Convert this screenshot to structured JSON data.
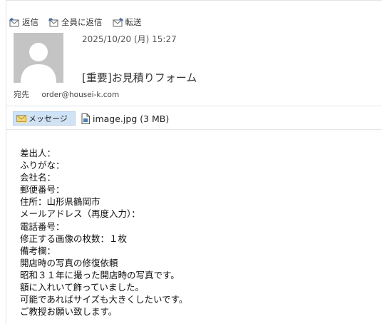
{
  "toolbar": {
    "reply_label": "返信",
    "reply_all_label": "全員に返信",
    "forward_label": "転送"
  },
  "message": {
    "date": "2025/10/20 (月) 15:27",
    "subject": "[重要]お見積りフォーム",
    "to_label": "宛先",
    "to_address": "order@housei-k.com"
  },
  "attachments": {
    "message_tab_label": "メッセージ",
    "file_label": "image.jpg (3 MB)"
  },
  "body_lines": [
    "差出人：",
    "ふりがな：",
    "会社名：",
    "郵便番号：",
    "住所：山形県鶴岡市",
    "メールアドレス（再度入力）：",
    "電話番号：",
    "修正する画像の枚数：１枚",
    "備考欄：",
    "開店時の写真の修復依頼",
    "昭和３１年に撮った開店時の写真です。",
    "額に入れいて飾っていました。",
    "可能であればサイズも大きくしたいです。",
    "ご教授お願い致します。"
  ],
  "colors": {
    "accent_tab": "#cfe3f5",
    "avatar_bg": "#c4c4c4"
  }
}
